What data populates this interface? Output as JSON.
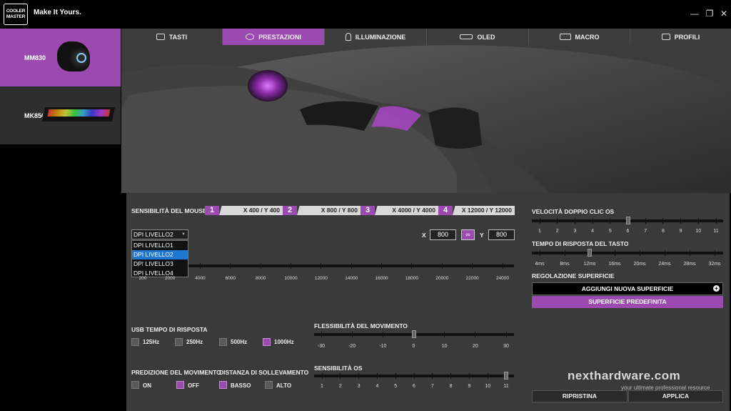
{
  "brand": {
    "logo_line1": "COOLER",
    "logo_line2": "MASTER",
    "tagline": "Make It Yours."
  },
  "window_controls": [
    "minimize-icon",
    "restore-icon",
    "close-icon"
  ],
  "devices": [
    {
      "name": "MM830",
      "active": true
    },
    {
      "name": "MK850",
      "active": false
    }
  ],
  "tabs": [
    {
      "label": "TASTI",
      "icon": "keyboard-icon",
      "active": false
    },
    {
      "label": "PRESTAZIONI",
      "icon": "speed-icon",
      "active": true
    },
    {
      "label": "ILLUMINAZIONE",
      "icon": "bulb-icon",
      "active": false
    },
    {
      "label": "OLED",
      "icon": "oled-icon",
      "active": false
    },
    {
      "label": "MACRO",
      "icon": "macro-icon",
      "active": false
    },
    {
      "label": "PROFILI",
      "icon": "profile-icon",
      "active": false
    }
  ],
  "dpi": {
    "section_label": "SENSIBILITÀ DEL MOUSE",
    "levels": [
      {
        "num": "1",
        "value": "X 400 / Y 400"
      },
      {
        "num": "2",
        "value": "X 800 / Y 800"
      },
      {
        "num": "3",
        "value": "X 4000 / Y 4000"
      },
      {
        "num": "4",
        "value": "X 12000 / Y 12000"
      }
    ],
    "selected_level": "DPI LIVELLO2",
    "level_options": [
      "DPI LIVELLO1",
      "DPI LIVELLO2",
      "DPI LIVELLO3",
      "DPI LIVELLO4"
    ],
    "x_label": "X",
    "x_value": "800",
    "y_label": "Y",
    "y_value": "800",
    "scale_ticks": [
      "200",
      "2000",
      "4000",
      "6000",
      "8000",
      "10000",
      "12000",
      "14000",
      "16000",
      "18000",
      "20000",
      "22000",
      "24000"
    ]
  },
  "usb_polling": {
    "label": "USB TEMPO DI RISPOSTA",
    "options": [
      {
        "label": "125Hz",
        "checked": false
      },
      {
        "label": "250Hz",
        "checked": false
      },
      {
        "label": "500Hz",
        "checked": false
      },
      {
        "label": "1000Hz",
        "checked": true
      }
    ]
  },
  "angle_snapping": {
    "label": "PREDIZIONE DEL MOVIMENTO",
    "options": [
      {
        "label": "ON",
        "checked": false
      },
      {
        "label": "OFF",
        "checked": true
      }
    ]
  },
  "lift_off": {
    "label": "DISTANZA DI SOLLEVAMENTO",
    "options": [
      {
        "label": "BASSO",
        "checked": true
      },
      {
        "label": "ALTO",
        "checked": false
      }
    ]
  },
  "movement_flex": {
    "label": "FLESSIBILITÀ DEL MOVIMENTO",
    "ticks": [
      "-30",
      "-20",
      "-10",
      "0",
      "10",
      "20",
      "30"
    ],
    "value": 0
  },
  "os_sensitivity": {
    "label": "SENSIBILITÀ OS",
    "ticks": [
      "1",
      "2",
      "3",
      "4",
      "5",
      "6",
      "7",
      "8",
      "9",
      "10",
      "11"
    ],
    "value": 11
  },
  "double_click": {
    "label": "VELOCITÀ DOPPIO CLIC OS",
    "ticks": [
      "1",
      "2",
      "3",
      "4",
      "5",
      "6",
      "7",
      "8",
      "9",
      "10",
      "11"
    ],
    "value": 6
  },
  "debounce": {
    "label": "TEMPO DI RISPOSTA DEL TASTO",
    "ticks": [
      "4ms",
      "8ms",
      "12ms",
      "16ms",
      "20ms",
      "24ms",
      "28ms",
      "32ms"
    ],
    "value": "12ms"
  },
  "surface": {
    "label": "REGOLAZIONE SUPERFICIE",
    "add_label": "AGGIUNGI NUOVA SUPERFICIE",
    "default_label": "SUPERFICIE PREDEFINITA"
  },
  "actions": {
    "reset": "RIPRISTINA",
    "apply": "APPLICA"
  },
  "watermark": {
    "name": "nexthardware.com",
    "tagline": "your ultimate professional resource"
  }
}
